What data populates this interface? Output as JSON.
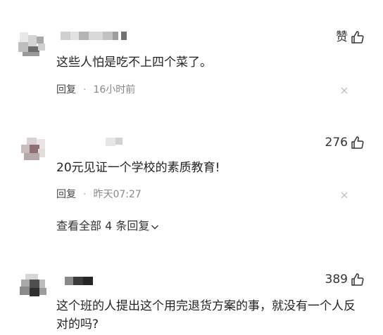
{
  "comments": [
    {
      "like_label": "赞",
      "content": "这些人怕是吃不上四个菜了。",
      "reply_label": "回复",
      "separator": "·",
      "time": "16小时前"
    },
    {
      "like_count": "276",
      "content": "20元见证一个学校的素质教育!",
      "reply_label": "回复",
      "separator": "·",
      "time": "昨天07:27",
      "view_all": "查看全部 4 条回复"
    },
    {
      "like_count": "389",
      "content": "这个班的人提出这个用完退货方案的事，就没有一个人反对的吗?"
    }
  ],
  "icons": {
    "thumb": "thumbs-up-icon",
    "close": "close-icon",
    "chevron": "chevron-down-icon"
  },
  "colors": {
    "text": "#222222",
    "meta": "#888888",
    "icon": "#333333"
  }
}
